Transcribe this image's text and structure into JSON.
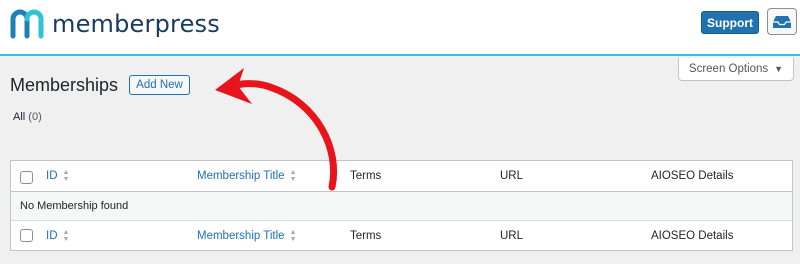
{
  "brand": {
    "name": "memberpress",
    "logo_icon": "memberpress-m-logo-icon",
    "logo_colors": [
      "#1f7fb8",
      "#2fc3d8"
    ]
  },
  "header": {
    "support_label": "Support",
    "inbox_icon": "inbox-icon"
  },
  "screen_options": {
    "label": "Screen Options",
    "caret": "▼"
  },
  "page": {
    "title": "Memberships",
    "add_new_label": "Add New"
  },
  "filters": {
    "all_label": "All",
    "all_count": "(0)"
  },
  "table": {
    "columns": [
      "ID",
      "Membership Title",
      "Terms",
      "URL",
      "AIOSEO Details"
    ],
    "sortable": [
      true,
      true,
      false,
      false,
      false
    ],
    "empty_message": "No Membership found"
  },
  "annotation": {
    "type": "red-curved-arrow",
    "color": "#e8141b",
    "points_to": "add-new-button"
  }
}
